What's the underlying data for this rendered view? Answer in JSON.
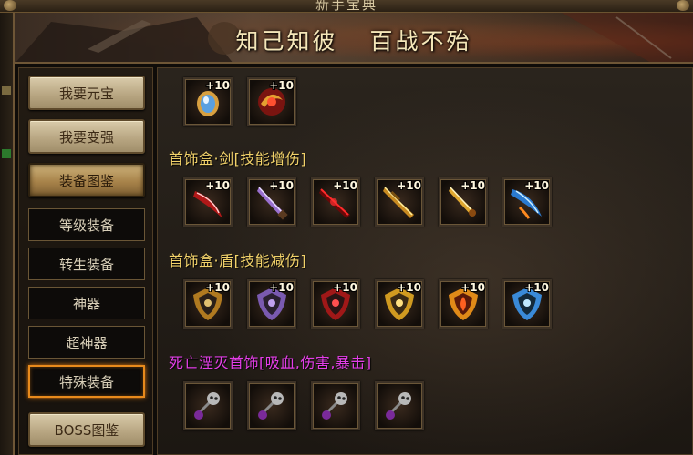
{
  "window": {
    "title": "新手宝典"
  },
  "banner": {
    "slogan_left": "知己知彼",
    "slogan_right": "百战不殆"
  },
  "sidebar": {
    "main_items": [
      {
        "label": "我要元宝"
      },
      {
        "label": "我要变强"
      },
      {
        "label": "装备图鉴"
      }
    ],
    "sub_items": [
      {
        "label": "等级装备"
      },
      {
        "label": "转生装备"
      },
      {
        "label": "神器"
      },
      {
        "label": "超神器"
      },
      {
        "label": "特殊装备"
      }
    ],
    "bottom_item": {
      "label": "BOSS图鉴"
    },
    "active_main": "装备图鉴",
    "selected_sub": "特殊装备"
  },
  "content": {
    "top_row": [
      {
        "icon": "gem-amulet-icon",
        "plus": "+10"
      },
      {
        "icon": "crimson-orb-icon",
        "plus": "+10"
      }
    ],
    "sections": [
      {
        "title": "首饰盒·剑[技能增伤]",
        "title_color": "#f2d26a",
        "items": [
          {
            "icon": "red-blade-icon",
            "plus": "+10"
          },
          {
            "icon": "purple-dagger-icon",
            "plus": "+10"
          },
          {
            "icon": "crimson-sword-icon",
            "plus": "+10"
          },
          {
            "icon": "golden-greatsword-icon",
            "plus": "+10"
          },
          {
            "icon": "golden-sword-icon",
            "plus": "+10"
          },
          {
            "icon": "blue-flame-blade-icon",
            "plus": "+10"
          }
        ]
      },
      {
        "title": "首饰盒·盾[技能减伤]",
        "title_color": "#f2d26a",
        "items": [
          {
            "icon": "gold-shield-icon",
            "plus": "+10"
          },
          {
            "icon": "violet-shield-icon",
            "plus": "+10"
          },
          {
            "icon": "red-shield-icon",
            "plus": "+10"
          },
          {
            "icon": "amber-shield-icon",
            "plus": "+10"
          },
          {
            "icon": "flame-shield-icon",
            "plus": "+10"
          },
          {
            "icon": "ice-shield-icon",
            "plus": "+10"
          }
        ]
      },
      {
        "title": "死亡湮灭首饰[吸血,伤害,暴击]",
        "title_color": "#e23ee6",
        "items": [
          {
            "icon": "skull-pendant-icon"
          },
          {
            "icon": "skull-pendant-icon"
          },
          {
            "icon": "skull-pendant-icon"
          },
          {
            "icon": "skull-pendant-icon"
          }
        ]
      }
    ]
  }
}
